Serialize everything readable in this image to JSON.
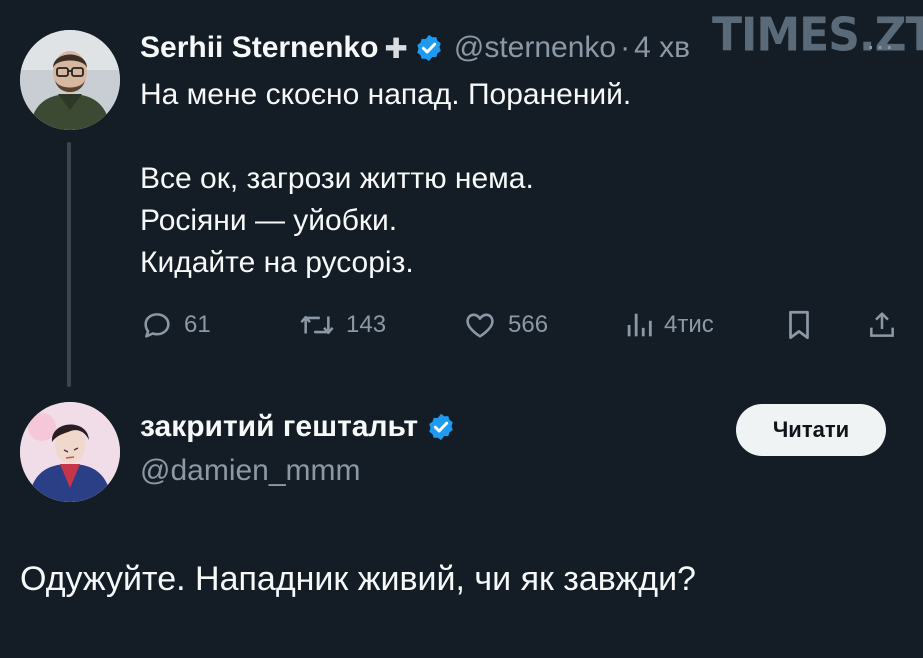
{
  "watermark": "TIMES.ZT",
  "tweet1": {
    "author_name": "Serhii Sternenko",
    "badge_icon": "plus-icon",
    "verified_icon": "verified-badge-icon",
    "handle": "@sternenko",
    "separator": "·",
    "time": "4 хв",
    "more_icon": "more-icon",
    "lines": [
      "На мене скоєно напад. Поранений.",
      "Все ок, загрози життю нема.",
      "Росіяни — уйобки.",
      "Кидайте на русоріз."
    ],
    "actions": {
      "reply_count": "61",
      "retweet_count": "143",
      "like_count": "566",
      "views_count": "4тис"
    }
  },
  "tweet2": {
    "author_name": "закритий гештальт",
    "verified_icon": "verified-badge-icon",
    "handle": "@damien_mmm",
    "follow_label": "Читати",
    "text": "Одужуйте. Нападник живий, чи як завжди?"
  },
  "colors": {
    "background": "#141d26",
    "text": "#f7f9f9",
    "muted": "#8b98a5",
    "verified": "#1d9bf0"
  }
}
